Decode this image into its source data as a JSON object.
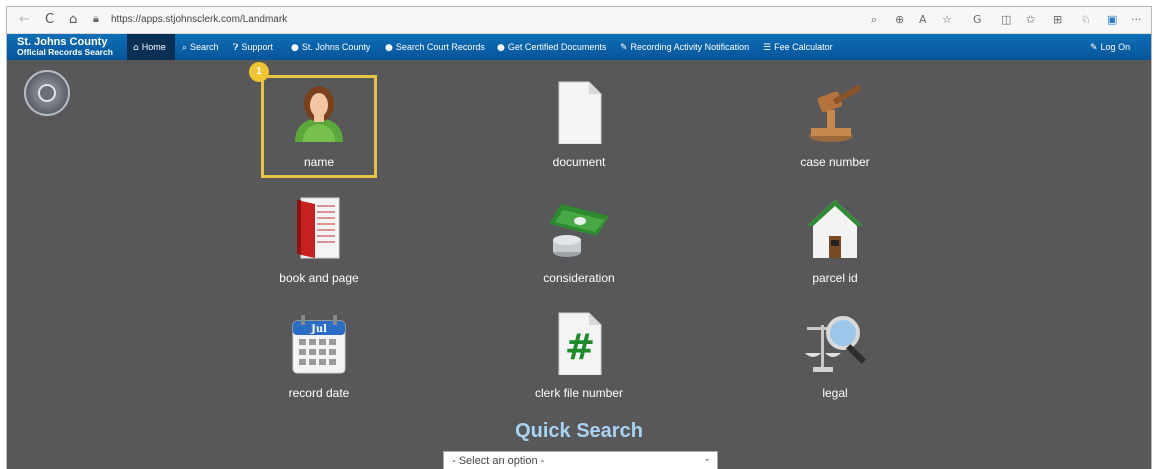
{
  "browser": {
    "url": "https://apps.stjohnsclerk.com/Landmark",
    "back_icon": "←",
    "reload_icon": "C",
    "home_icon": "⌂",
    "lock_icon": "🔒",
    "toolbar_icons": [
      "search-web-icon",
      "zoom-icon",
      "read-aloud-icon",
      "favorite-icon",
      "copilot-icon",
      "split-screen-icon",
      "favorites-bar-icon",
      "collections-icon",
      "extension-icon",
      "office-icon",
      "more-icon"
    ],
    "toolbar_glyphs": [
      "⌕",
      "⊕",
      "A",
      "☆",
      "G",
      "◫",
      "✩",
      "⊞",
      "♘",
      "▣",
      "···"
    ]
  },
  "site": {
    "brand_line1": "St. Johns County",
    "brand_line2": "Official Records Search",
    "nav": [
      {
        "icon": "🏠",
        "label": "Home"
      },
      {
        "icon": "🔍",
        "label": "Search"
      },
      {
        "icon": "❓",
        "label": "Support"
      },
      {
        "icon": "🌐",
        "label": "St. Johns County"
      },
      {
        "icon": "🌐",
        "label": "Search Court Records"
      },
      {
        "icon": "🌐",
        "label": "Get Certified Documents"
      },
      {
        "icon": "🔧",
        "label": "Recording Activity Notification"
      },
      {
        "icon": "☰",
        "label": "Fee Calculator"
      }
    ],
    "logon": {
      "icon": "✏",
      "label": "Log On"
    }
  },
  "tiles": [
    {
      "id": "name",
      "label": "name",
      "icon": "person-icon"
    },
    {
      "id": "document",
      "label": "document",
      "icon": "document-icon"
    },
    {
      "id": "case-number",
      "label": "case number",
      "icon": "gavel-icon"
    },
    {
      "id": "book-and-page",
      "label": "book and page",
      "icon": "book-icon"
    },
    {
      "id": "consideration",
      "label": "consideration",
      "icon": "money-icon"
    },
    {
      "id": "parcel-id",
      "label": "parcel id",
      "icon": "house-icon"
    },
    {
      "id": "record-date",
      "label": "record date",
      "icon": "calendar-icon"
    },
    {
      "id": "clerk-file-number",
      "label": "clerk file number",
      "icon": "hash-document-icon"
    },
    {
      "id": "legal",
      "label": "legal",
      "icon": "scales-magnifier-icon"
    }
  ],
  "calendar_month": "Jul",
  "hash_symbol": "#",
  "highlight_badge": "1",
  "quick_search": {
    "title": "Quick Search",
    "select_value": "- Select an option -",
    "chevron": "⌄"
  },
  "colors": {
    "nav_bar": "#0a63ad",
    "page_background": "#58585a",
    "highlight": "#e7c542",
    "quick_search_title": "#a9d3f3"
  }
}
